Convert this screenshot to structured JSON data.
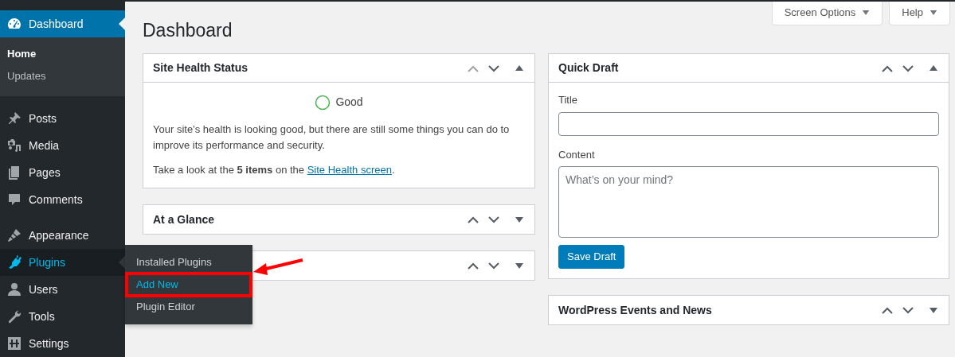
{
  "sidebar": {
    "groups": [
      [
        {
          "label": "Dashboard",
          "selected": true,
          "hovered": false,
          "submenu": [
            {
              "label": "Home",
              "selected": true
            },
            {
              "label": "Updates",
              "selected": false
            }
          ]
        }
      ],
      [
        {
          "label": "Posts",
          "selected": false,
          "hovered": false
        },
        {
          "label": "Media",
          "selected": false,
          "hovered": false
        },
        {
          "label": "Pages",
          "selected": false,
          "hovered": false
        },
        {
          "label": "Comments",
          "selected": false,
          "hovered": false
        }
      ],
      [
        {
          "label": "Appearance",
          "selected": false,
          "hovered": false
        },
        {
          "label": "Plugins",
          "selected": false,
          "hovered": true,
          "flyout": [
            {
              "label": "Installed Plugins",
              "highlighted": false,
              "annotated": false
            },
            {
              "label": "Add New",
              "highlighted": true,
              "annotated": true
            },
            {
              "label": "Plugin Editor",
              "highlighted": false,
              "annotated": false
            }
          ]
        },
        {
          "label": "Users",
          "selected": false,
          "hovered": false
        },
        {
          "label": "Tools",
          "selected": false,
          "hovered": false
        },
        {
          "label": "Settings",
          "selected": false,
          "hovered": false
        }
      ]
    ]
  },
  "top_buttons": [
    "Screen Options",
    "Help"
  ],
  "page_title": "Dashboard",
  "columns": [
    [
      {
        "kind": "site_health",
        "title": "Site Health Status",
        "expanded": true,
        "move_up_disabled": true,
        "status": "Good",
        "paragraph": "Your site’s health is looking good, but there are still some things you can do to improve its performance and security.",
        "link_prefix": "Take a look at the **5 items** on the ",
        "link": "Site Health screen",
        "link_suffix": "."
      },
      {
        "title": "At a Glance",
        "expanded": false,
        "move_up_disabled": false
      },
      {
        "expanded": false,
        "move_up_disabled": false
      }
    ],
    [
      {
        "kind": "quick_draft",
        "title": "Quick Draft",
        "expanded": true,
        "move_up_disabled": false,
        "title_label": "Title",
        "content_label": "Content",
        "content_placeholder": "What’s on your mind?",
        "button": "Save Draft"
      },
      {
        "title": "WordPress Events and News",
        "expanded": false,
        "move_up_disabled": false
      }
    ]
  ]
}
